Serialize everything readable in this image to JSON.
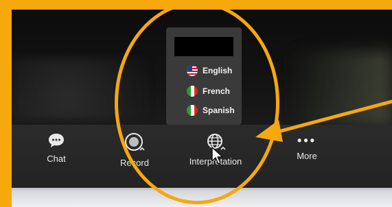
{
  "colors": {
    "frame": "#f7a80d",
    "toolbar": "#2b2b2c",
    "popup": "#3a3a3b",
    "annotation": "#f7a80d",
    "text": "#e9e9e9"
  },
  "toolbar": {
    "items": [
      {
        "label": "Chat",
        "icon": "chat-bubble-icon"
      },
      {
        "label": "Record",
        "icon": "record-icon"
      },
      {
        "label": "Interpretation",
        "icon": "globe-icon"
      },
      {
        "label": "More",
        "icon": "more-dots-icon"
      }
    ]
  },
  "interpretation_menu": {
    "languages": [
      {
        "label": "English",
        "flag": "us-flag-icon"
      },
      {
        "label": "French",
        "flag": "france-flag-icon"
      },
      {
        "label": "Spanish",
        "flag": "spain-flag-icon"
      }
    ]
  }
}
